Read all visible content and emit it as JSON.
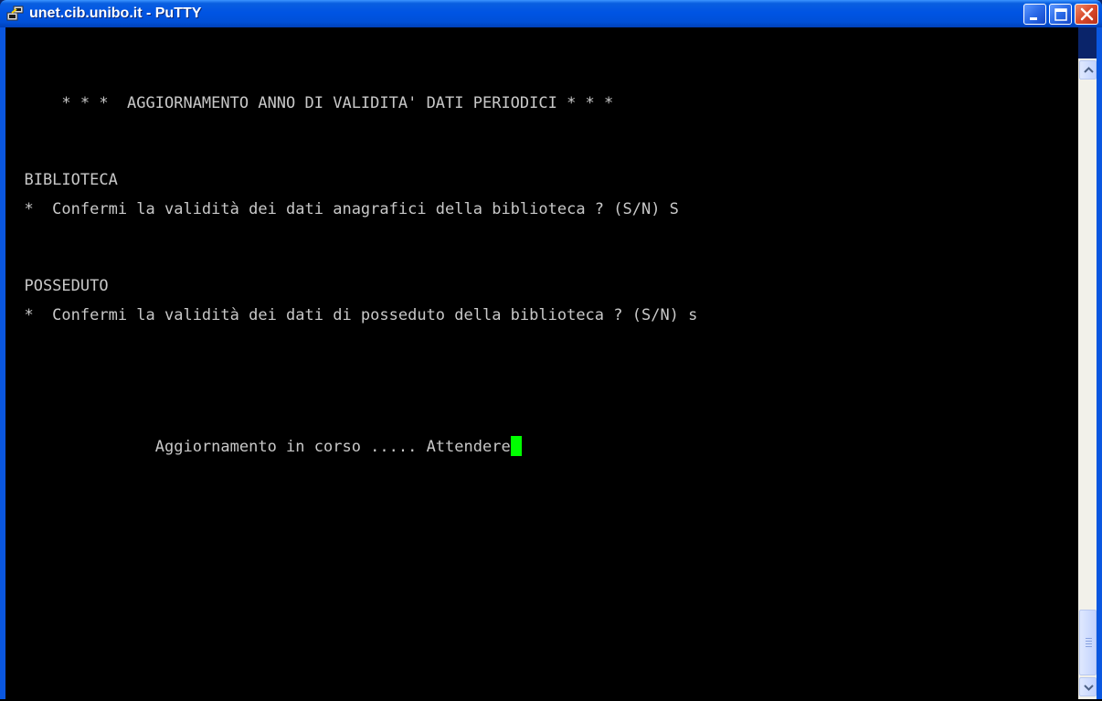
{
  "window": {
    "title": "unet.cib.unibo.it - PuTTY",
    "icon": "putty-icon",
    "controls": [
      "minimize-icon",
      "maximize-icon",
      "close-icon"
    ]
  },
  "terminal": {
    "lines": {
      "header": "      * * *  AGGIORNAMENTO ANNO DI VALIDITA' DATI PERIODICI * * *",
      "section1_title": "  BIBLIOTECA",
      "section1_prompt": "  *  Confermi la validità dei dati anagrafici della biblioteca ? (S/N) S",
      "section2_title": "  POSSEDUTO",
      "section2_prompt": "  *  Confermi la validità dei dati di posseduto della biblioteca ? (S/N) s",
      "status": "                Aggiornamento in corso ..... Attendere"
    },
    "colors": {
      "text": "#c8c8c8",
      "background": "#000000",
      "cursor": "#00ff00"
    }
  },
  "scrollbar": {
    "up_icon": "chevron-up-icon",
    "down_icon": "chevron-down-icon"
  }
}
